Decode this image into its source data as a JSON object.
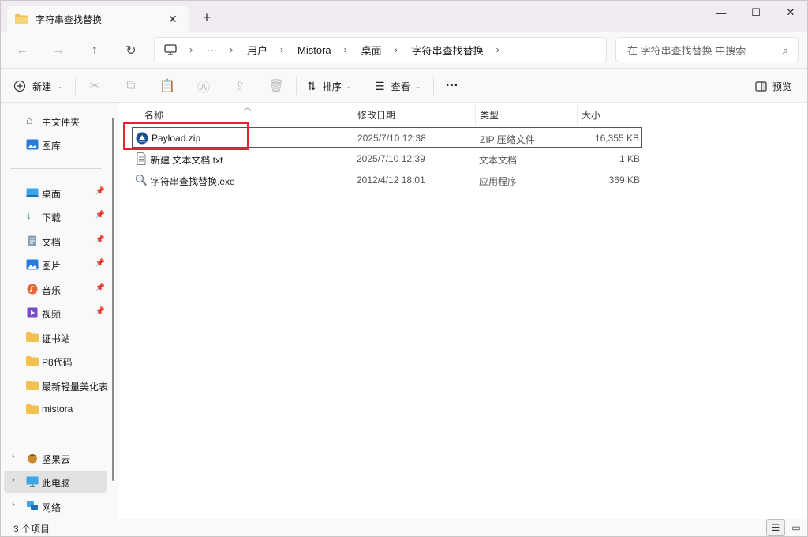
{
  "window": {
    "tab_title": "字符串查找替换",
    "tab_close": "✕",
    "new_tab": "+",
    "controls": {
      "minimize": "—",
      "maximize": "☐",
      "close": "✕"
    }
  },
  "nav": {
    "back": "←",
    "forward": "→",
    "up": "↑",
    "refresh": "↻",
    "breadcrumb": [
      "用户",
      "Mistora",
      "桌面",
      "字符串查找替换"
    ],
    "ellipsis": "···",
    "search_placeholder": "在 字符串查找替换 中搜索"
  },
  "toolbar": {
    "new_label": "新建",
    "sort_label": "排序",
    "view_label": "查看",
    "more": "···",
    "preview_label": "预览"
  },
  "sidebar": {
    "home": "主文件夹",
    "gallery": "图库",
    "pinned": [
      {
        "label": "桌面",
        "icon": "desktop-icon"
      },
      {
        "label": "下载",
        "icon": "download-icon"
      },
      {
        "label": "文档",
        "icon": "document-icon"
      },
      {
        "label": "图片",
        "icon": "picture-icon"
      },
      {
        "label": "音乐",
        "icon": "music-icon"
      },
      {
        "label": "视频",
        "icon": "video-icon"
      }
    ],
    "folders": [
      "证书站",
      "P8代码",
      "最新轻量美化表",
      "mistora"
    ],
    "bottom": [
      {
        "label": "坚果云",
        "icon": "nutstore-icon"
      },
      {
        "label": "此电脑",
        "icon": "computer-icon",
        "selected": true
      },
      {
        "label": "网络",
        "icon": "network-icon"
      }
    ]
  },
  "columns": {
    "name": "名称",
    "date": "修改日期",
    "type": "类型",
    "size": "大小"
  },
  "files": [
    {
      "name": "Payload.zip",
      "date": "2025/7/10 12:38",
      "type": "ZIP 压缩文件",
      "size": "16,355 KB",
      "icon": "zip-icon",
      "selected": true
    },
    {
      "name": "新建 文本文档.txt",
      "date": "2025/7/10 12:39",
      "type": "文本文档",
      "size": "1 KB",
      "icon": "text-file-icon"
    },
    {
      "name": "字符串查找替换.exe",
      "date": "2012/4/12 18:01",
      "type": "应用程序",
      "size": "369 KB",
      "icon": "magnifier-app-icon"
    }
  ],
  "status": {
    "item_count": "3 个项目"
  },
  "colors": {
    "highlight_box": "#e5242b",
    "folder": "#f2c14e",
    "accent": "#0067c0"
  }
}
